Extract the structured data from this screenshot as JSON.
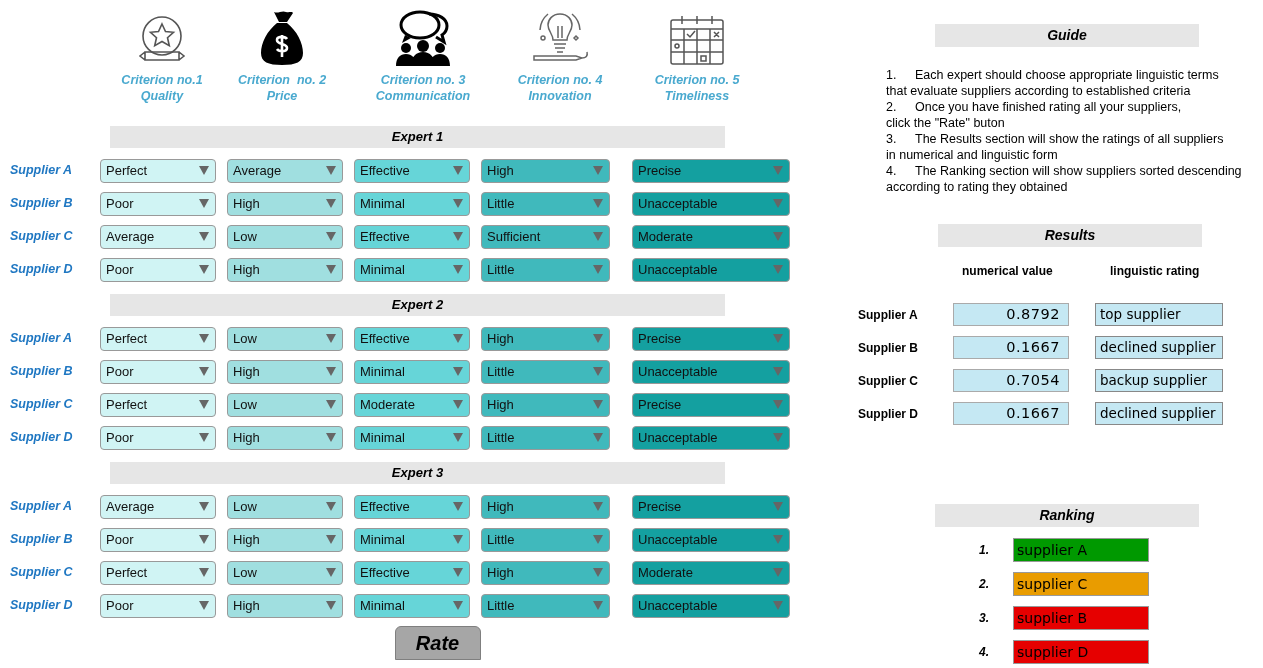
{
  "criteria": [
    {
      "kind": "badge",
      "label": "Criterion no.1",
      "name": "Quality"
    },
    {
      "kind": "moneybag",
      "label": "Criterion  no. 2",
      "name": "Price"
    },
    {
      "kind": "people",
      "label": "Criterion no. 3",
      "name": "Communication"
    },
    {
      "kind": "bulb",
      "label": "Criterion no. 4",
      "name": "Innovation"
    },
    {
      "kind": "calendar",
      "label": "Criterion no. 5",
      "name": "Timeliness"
    }
  ],
  "experts": [
    {
      "title": "Expert 1",
      "rows": [
        {
          "supplier": "Supplier A",
          "ratings": [
            "Perfect",
            "Average",
            "Effective",
            "High",
            "Precise"
          ]
        },
        {
          "supplier": "Supplier B",
          "ratings": [
            "Poor",
            "High",
            "Minimal",
            "Little",
            "Unacceptable"
          ]
        },
        {
          "supplier": "Supplier C",
          "ratings": [
            "Average",
            "Low",
            "Effective",
            "Sufficient",
            "Moderate"
          ]
        },
        {
          "supplier": "Supplier D",
          "ratings": [
            "Poor",
            "High",
            "Minimal",
            "Little",
            "Unacceptable"
          ]
        }
      ]
    },
    {
      "title": "Expert 2",
      "rows": [
        {
          "supplier": "Supplier A",
          "ratings": [
            "Perfect",
            "Low",
            "Effective",
            "High",
            "Precise"
          ]
        },
        {
          "supplier": "Supplier B",
          "ratings": [
            "Poor",
            "High",
            "Minimal",
            "Little",
            "Unacceptable"
          ]
        },
        {
          "supplier": "Supplier C",
          "ratings": [
            "Perfect",
            "Low",
            "Moderate",
            "High",
            "Precise"
          ]
        },
        {
          "supplier": "Supplier D",
          "ratings": [
            "Poor",
            "High",
            "Minimal",
            "Little",
            "Unacceptable"
          ]
        }
      ]
    },
    {
      "title": "Expert 3",
      "rows": [
        {
          "supplier": "Supplier A",
          "ratings": [
            "Average",
            "Low",
            "Effective",
            "High",
            "Precise"
          ]
        },
        {
          "supplier": "Supplier B",
          "ratings": [
            "Poor",
            "High",
            "Minimal",
            "Little",
            "Unacceptable"
          ]
        },
        {
          "supplier": "Supplier C",
          "ratings": [
            "Perfect",
            "Low",
            "Effective",
            "High",
            "Moderate"
          ]
        },
        {
          "supplier": "Supplier D",
          "ratings": [
            "Poor",
            "High",
            "Minimal",
            "Little",
            "Unacceptable"
          ]
        }
      ]
    }
  ],
  "rate_button": "Rate",
  "guide": {
    "title": "Guide",
    "steps": [
      {
        "number": "1.",
        "first_line": "Each expert should choose appropriate linguistic terms",
        "rest": "that evaluate suppliers according to established criteria"
      },
      {
        "number": "2.",
        "first_line": "Once you have finished rating all your suppliers,",
        "rest": "click the \"Rate\" buton"
      },
      {
        "number": "3.",
        "first_line": "The Results section will show the ratings of all suppliers",
        "rest": "in numerical and linguistic form"
      },
      {
        "number": "4.",
        "first_line": "The Ranking section will show suppliers sorted descending",
        "rest": "according to rating they obtained"
      }
    ]
  },
  "results": {
    "title": "Results",
    "columns": [
      "numerical value",
      "linguistic rating"
    ],
    "rows": [
      {
        "supplier": "Supplier A",
        "value": "0.8792",
        "rating": "top supplier"
      },
      {
        "supplier": "Supplier B",
        "value": "0.1667",
        "rating": "declined supplier"
      },
      {
        "supplier": "Supplier C",
        "value": "0.7054",
        "rating": "backup supplier"
      },
      {
        "supplier": "Supplier D",
        "value": "0.1667",
        "rating": "declined supplier"
      }
    ]
  },
  "ranking": {
    "title": "Ranking",
    "items": [
      {
        "rank": "1.",
        "label": "supplier A",
        "color": "#009900"
      },
      {
        "rank": "2.",
        "label": "supplier C",
        "color": "#e99c00"
      },
      {
        "rank": "3.",
        "label": "supplier B",
        "color": "#e60000"
      },
      {
        "rank": "4.",
        "label": "supplier D",
        "color": "#e60000"
      }
    ]
  }
}
